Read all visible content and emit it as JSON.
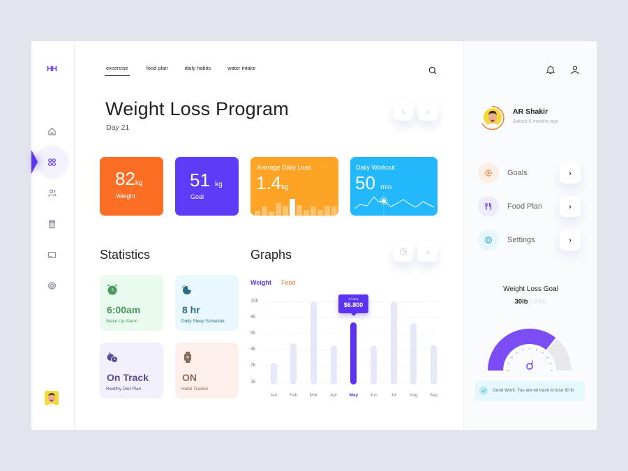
{
  "app": {
    "logo_text": "HH"
  },
  "sidebar": {
    "items": [
      {
        "name": "home",
        "icon": "home-icon",
        "active": false
      },
      {
        "name": "dashboard",
        "icon": "grid-icon",
        "active": true
      },
      {
        "name": "users",
        "icon": "users-icon",
        "active": false
      },
      {
        "name": "calculator",
        "icon": "calculator-icon",
        "active": false
      },
      {
        "name": "card",
        "icon": "credit-card-icon",
        "active": false
      },
      {
        "name": "settings",
        "icon": "gear-icon",
        "active": false
      }
    ]
  },
  "header": {
    "tabs": [
      {
        "label": "excercise",
        "active": true
      },
      {
        "label": "food plan",
        "active": false
      },
      {
        "label": "daily habits",
        "active": false
      },
      {
        "label": "water intake",
        "active": false
      }
    ],
    "title": "Weight Loss Program",
    "subtitle": "Day 21"
  },
  "cards": {
    "weight": {
      "value": "82",
      "unit": "kg",
      "label": "Weight",
      "color": "#fb6e24"
    },
    "goal": {
      "value": "51",
      "unit": "kg",
      "label": "Goal",
      "color": "#5d3cf7"
    },
    "avg_loss": {
      "label": "Average Daily Loss",
      "value": "1.4",
      "unit": "kg",
      "color": "#fda426",
      "mini_bars": [
        0.25,
        0.45,
        0.2,
        0.65,
        0.5,
        0.85,
        0.55,
        0.3,
        0.45,
        0.3,
        0.5,
        0.45
      ],
      "highlight_index": 5
    },
    "workout": {
      "label": "Daily Workout",
      "value": "50",
      "unit": "min",
      "color": "#22b8fb"
    }
  },
  "statistics": {
    "title": "Statistics",
    "items": [
      {
        "value": "6:00am",
        "label": "Wake Up Alarm",
        "icon": "alarm-clock-icon",
        "bg": "#e9fbee",
        "color": "#4a9a5e"
      },
      {
        "value": "8 hr",
        "label": "Daily Sleep Schedule",
        "icon": "moon-sleep-icon",
        "bg": "#e8f8fd",
        "color": "#2d6b82"
      },
      {
        "value": "On Track",
        "label": "Healthy Diet Plan",
        "icon": "fruit-icon",
        "bg": "#f2f0fd",
        "color": "#5a4a94"
      },
      {
        "value": "ON",
        "label": "Habit Tracker",
        "icon": "smartwatch-icon",
        "bg": "#fdf0ea",
        "color": "#8a6a5e"
      }
    ]
  },
  "graphs": {
    "title": "Graphs",
    "legend": {
      "weight": "Weight",
      "food": "Food"
    },
    "tooltip": {
      "date": "17 May",
      "value": "$6.800"
    }
  },
  "chart_data": {
    "type": "bar",
    "categories": [
      "Jan",
      "Feb",
      "Mar",
      "Apr",
      "May",
      "Jun",
      "Jul",
      "Aug",
      "Sep"
    ],
    "series": [
      {
        "name": "Weight",
        "values": [
          2600,
          5000,
          10000,
          4700,
          7500,
          4700,
          10000,
          7400,
          4700
        ]
      }
    ],
    "selected_index": 4,
    "y_ticks": [
      "10k",
      "8k",
      "6k",
      "4k",
      "2k",
      "1k"
    ],
    "ylim": [
      0,
      10000
    ],
    "grid": true,
    "legend": [
      "Weight",
      "Food"
    ],
    "legend_position": "top-left"
  },
  "right_panel": {
    "user": {
      "name": "AR Shakir",
      "joined": "Joined 6 months ago"
    },
    "menu": [
      {
        "label": "Goals",
        "icon": "target-icon",
        "bg": "#fdeee6",
        "color": "#f47a33"
      },
      {
        "label": "Food Plan",
        "icon": "utensils-icon",
        "bg": "#eeebfd",
        "color": "#5b33f0"
      },
      {
        "label": "Settings",
        "icon": "gear-icon",
        "bg": "#e6f7fd",
        "color": "#22a6d8"
      }
    ],
    "goal": {
      "title": "Weight Loss Goal",
      "current": "30lb",
      "separator": " / ",
      "target": "24lb",
      "progress": 0.72
    },
    "toast": "Good Work. You are on track to lose 30 lb"
  }
}
